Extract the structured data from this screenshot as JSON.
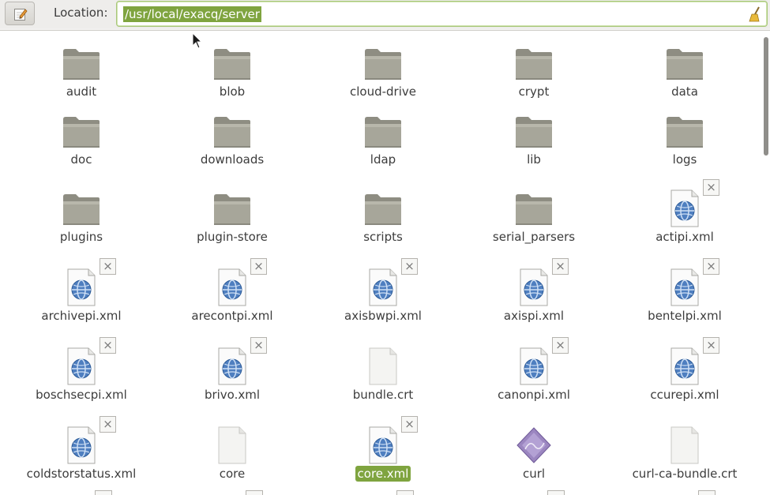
{
  "location": {
    "label": "Location:",
    "path": "/usr/local/exacq/server"
  },
  "files": [
    {
      "name": "audit",
      "type": "folder"
    },
    {
      "name": "blob",
      "type": "folder"
    },
    {
      "name": "cloud-drive",
      "type": "folder"
    },
    {
      "name": "crypt",
      "type": "folder"
    },
    {
      "name": "data",
      "type": "folder"
    },
    {
      "name": "doc",
      "type": "folder"
    },
    {
      "name": "downloads",
      "type": "folder"
    },
    {
      "name": "ldap",
      "type": "folder"
    },
    {
      "name": "lib",
      "type": "folder"
    },
    {
      "name": "logs",
      "type": "folder"
    },
    {
      "name": "plugins",
      "type": "folder"
    },
    {
      "name": "plugin-store",
      "type": "folder"
    },
    {
      "name": "scripts",
      "type": "folder"
    },
    {
      "name": "serial_parsers",
      "type": "folder"
    },
    {
      "name": "actipi.xml",
      "type": "xml",
      "emblem": "x-emblem-icon"
    },
    {
      "name": "archivepi.xml",
      "type": "xml",
      "emblem": "x-emblem-icon"
    },
    {
      "name": "arecontpi.xml",
      "type": "xml",
      "emblem": "x-emblem-icon"
    },
    {
      "name": "axisbwpi.xml",
      "type": "xml",
      "emblem": "x-emblem-icon"
    },
    {
      "name": "axispi.xml",
      "type": "xml",
      "emblem": "x-emblem-icon"
    },
    {
      "name": "bentelpi.xml",
      "type": "xml",
      "emblem": "x-emblem-icon"
    },
    {
      "name": "boschsecpi.xml",
      "type": "xml",
      "emblem": "x-emblem-icon"
    },
    {
      "name": "brivo.xml",
      "type": "xml",
      "emblem": "x-emblem-icon"
    },
    {
      "name": "bundle.crt",
      "type": "blank"
    },
    {
      "name": "canonpi.xml",
      "type": "xml",
      "emblem": "x-emblem-icon"
    },
    {
      "name": "ccurepi.xml",
      "type": "xml",
      "emblem": "x-emblem-icon"
    },
    {
      "name": "coldstorstatus.xml",
      "type": "xml",
      "emblem": "x-emblem-icon"
    },
    {
      "name": "core",
      "type": "blank"
    },
    {
      "name": "core.xml",
      "type": "xml",
      "emblem": "x-emblem-icon",
      "selected": true
    },
    {
      "name": "curl",
      "type": "exec"
    },
    {
      "name": "curl-ca-bundle.crt",
      "type": "blank"
    }
  ],
  "colors": {
    "selection": "#7fa43f",
    "folder": "#a7a69a"
  }
}
